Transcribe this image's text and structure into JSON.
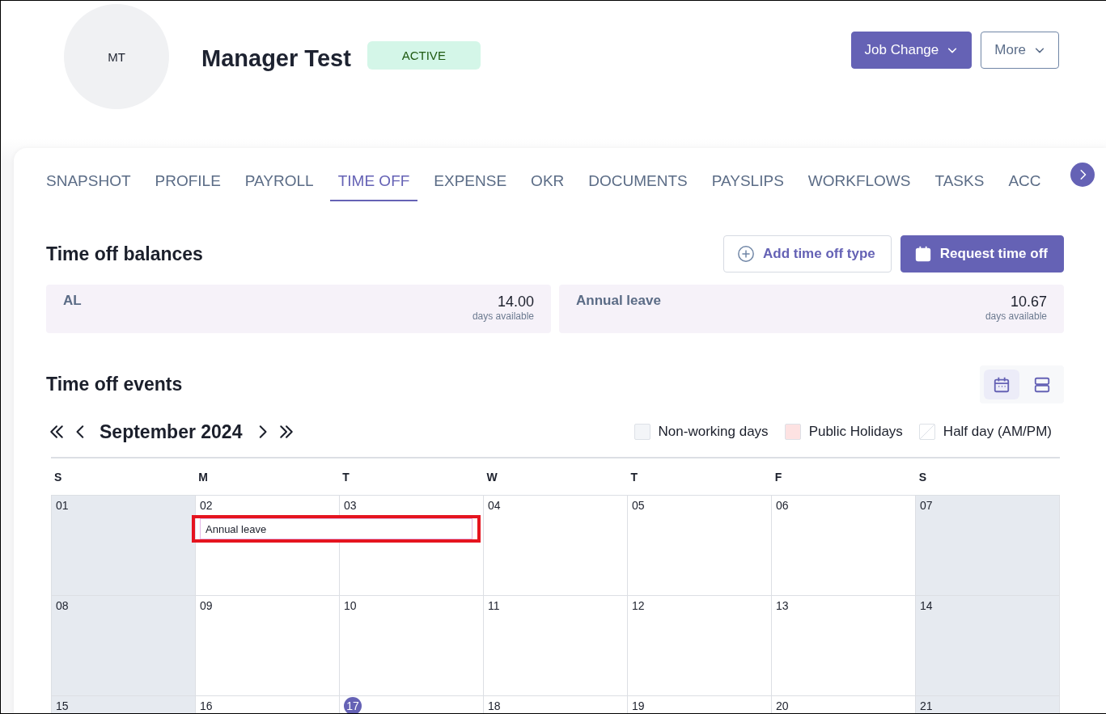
{
  "employee": {
    "initials": "MT",
    "name": "Manager Test",
    "status": "ACTIVE"
  },
  "header_buttons": [
    {
      "label": "Job Change",
      "kind": "primary"
    },
    {
      "label": "More",
      "kind": "outline"
    }
  ],
  "tabs": [
    {
      "label": "SNAPSHOT",
      "selected": false
    },
    {
      "label": "PROFILE",
      "selected": false
    },
    {
      "label": "PAYROLL",
      "selected": false
    },
    {
      "label": "TIME OFF",
      "selected": true
    },
    {
      "label": "EXPENSE",
      "selected": false
    },
    {
      "label": "OKR",
      "selected": false
    },
    {
      "label": "DOCUMENTS",
      "selected": false
    },
    {
      "label": "PAYSLIPS",
      "selected": false
    },
    {
      "label": "WORKFLOWS",
      "selected": false
    },
    {
      "label": "TASKS",
      "selected": false
    },
    {
      "label": "ACC",
      "selected": false
    }
  ],
  "balances": {
    "title": "Time off balances",
    "actions": [
      {
        "label": "Add time off type",
        "kind": "outline"
      },
      {
        "label": "Request time off",
        "kind": "primary"
      }
    ],
    "items": [
      {
        "name": "AL",
        "amount": "14.00",
        "unit": "days available"
      },
      {
        "name": "Annual leave",
        "amount": "10.67",
        "unit": "days available"
      }
    ]
  },
  "events": {
    "title": "Time off events",
    "views": [
      {
        "kind": "calendar",
        "selected": true
      },
      {
        "kind": "list",
        "selected": false
      }
    ],
    "month": "September 2024",
    "legend": [
      {
        "label": "Non-working days",
        "kind": "non_working"
      },
      {
        "label": "Public Holidays",
        "kind": "holiday"
      },
      {
        "label": "Half day (AM/PM)",
        "kind": "half_day"
      }
    ],
    "weekdays": [
      "S",
      "M",
      "T",
      "W",
      "T",
      "F",
      "S"
    ],
    "weeks": [
      {
        "event": {
          "label": "Annual leave",
          "highlighted": true
        },
        "days": [
          {
            "label": "01",
            "non_working": true,
            "leave": false,
            "today": false
          },
          {
            "label": "02",
            "non_working": false,
            "leave": true,
            "today": false
          },
          {
            "label": "03",
            "non_working": false,
            "leave": true,
            "today": false
          },
          {
            "label": "04",
            "non_working": false,
            "leave": false,
            "today": false
          },
          {
            "label": "05",
            "non_working": false,
            "leave": false,
            "today": false
          },
          {
            "label": "06",
            "non_working": false,
            "leave": false,
            "today": false
          },
          {
            "label": "07",
            "non_working": true,
            "leave": false,
            "today": false
          }
        ]
      },
      {
        "days": [
          {
            "label": "08",
            "non_working": true,
            "leave": false,
            "today": false
          },
          {
            "label": "09",
            "non_working": false,
            "leave": false,
            "today": false
          },
          {
            "label": "10",
            "non_working": false,
            "leave": false,
            "today": false
          },
          {
            "label": "11",
            "non_working": false,
            "leave": false,
            "today": false
          },
          {
            "label": "12",
            "non_working": false,
            "leave": false,
            "today": false
          },
          {
            "label": "13",
            "non_working": false,
            "leave": false,
            "today": false
          },
          {
            "label": "14",
            "non_working": true,
            "leave": false,
            "today": false
          }
        ]
      },
      {
        "days": [
          {
            "label": "15",
            "non_working": true,
            "leave": false,
            "today": false
          },
          {
            "label": "16",
            "non_working": false,
            "leave": false,
            "today": false
          },
          {
            "label": "17",
            "non_working": false,
            "leave": false,
            "today": true
          },
          {
            "label": "18",
            "non_working": false,
            "leave": false,
            "today": false
          },
          {
            "label": "19",
            "non_working": false,
            "leave": false,
            "today": false
          },
          {
            "label": "20",
            "non_working": false,
            "leave": false,
            "today": false
          },
          {
            "label": "21",
            "non_working": true,
            "leave": false,
            "today": false
          }
        ]
      }
    ]
  }
}
